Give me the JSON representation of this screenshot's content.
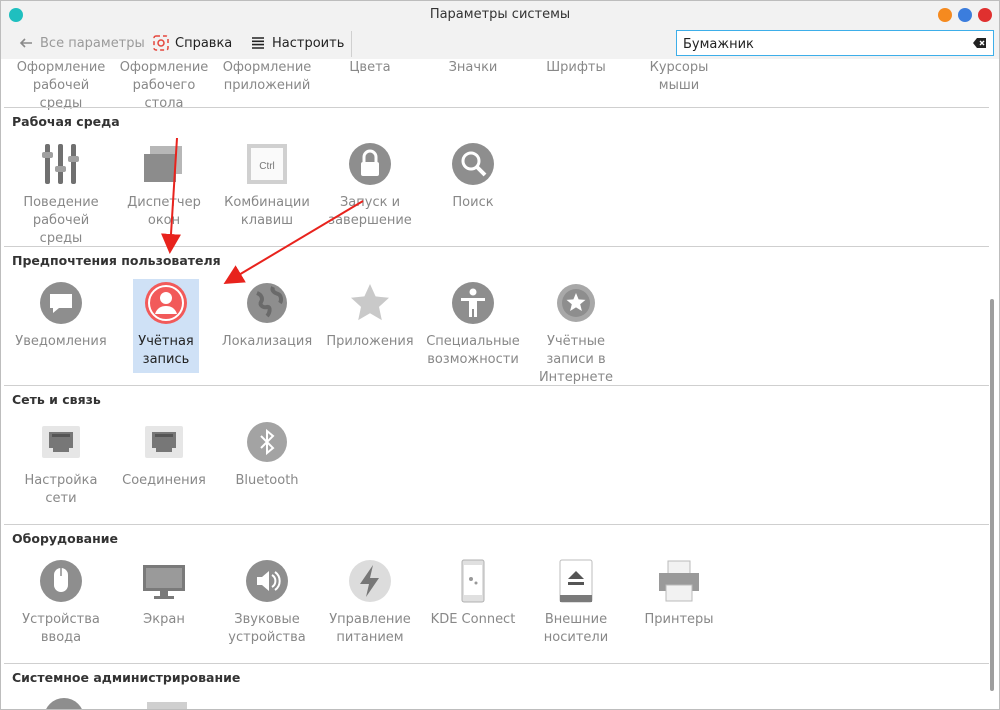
{
  "window": {
    "title": "Параметры системы"
  },
  "toolbar": {
    "back_label": "Все параметры",
    "help_label": "Справка",
    "configure_label": "Настроить"
  },
  "search": {
    "value": "Бумажник",
    "placeholder": ""
  },
  "partial_row": [
    "Оформление рабочей среды",
    "Оформление рабочего стола",
    "Оформление приложений",
    "Цвета",
    "Значки",
    "Шрифты",
    "Курсоры мыши"
  ],
  "sections": [
    {
      "title": "Рабочая среда",
      "items": [
        {
          "label": "Поведение рабочей среды",
          "icon": "sliders-icon"
        },
        {
          "label": "Диспетчер окон",
          "icon": "windows-icon"
        },
        {
          "label": "Комбинации клавиш",
          "icon": "keyboard-ctrl-icon"
        },
        {
          "label": "Запуск и завершение",
          "icon": "lock-icon"
        },
        {
          "label": "Поиск",
          "icon": "search-icon"
        }
      ]
    },
    {
      "title": "Предпочтения пользователя",
      "items": [
        {
          "label": "Уведомления",
          "icon": "notification-icon"
        },
        {
          "label": "Учётная запись",
          "icon": "user-account-icon",
          "selected": true
        },
        {
          "label": "Локализация",
          "icon": "globe-icon"
        },
        {
          "label": "Приложения",
          "icon": "star-icon"
        },
        {
          "label": "Специальные возможности",
          "icon": "accessibility-icon"
        },
        {
          "label": "Учётные записи в Интернете",
          "icon": "online-accounts-icon"
        }
      ]
    },
    {
      "title": "Сеть и связь",
      "items": [
        {
          "label": "Настройка сети",
          "icon": "network-port-icon"
        },
        {
          "label": "Соединения",
          "icon": "connections-port-icon"
        },
        {
          "label": "Bluetooth",
          "icon": "bluetooth-icon"
        }
      ]
    },
    {
      "title": "Оборудование",
      "items": [
        {
          "label": "Устройства ввода",
          "icon": "mouse-icon"
        },
        {
          "label": "Экран",
          "icon": "monitor-icon"
        },
        {
          "label": "Звуковые устройства",
          "icon": "speaker-icon"
        },
        {
          "label": "Управление питанием",
          "icon": "power-icon"
        },
        {
          "label": "KDE Connect",
          "icon": "phone-icon"
        },
        {
          "label": "Внешние носители",
          "icon": "eject-drive-icon"
        },
        {
          "label": "Принтеры",
          "icon": "printer-icon"
        }
      ]
    },
    {
      "title": "Системное администрирование",
      "items": []
    }
  ],
  "colors": {
    "accent": "#3daee9",
    "selection": "#cfe1f6",
    "arrow": "#e8231d",
    "user_icon": "#f25a5a"
  }
}
